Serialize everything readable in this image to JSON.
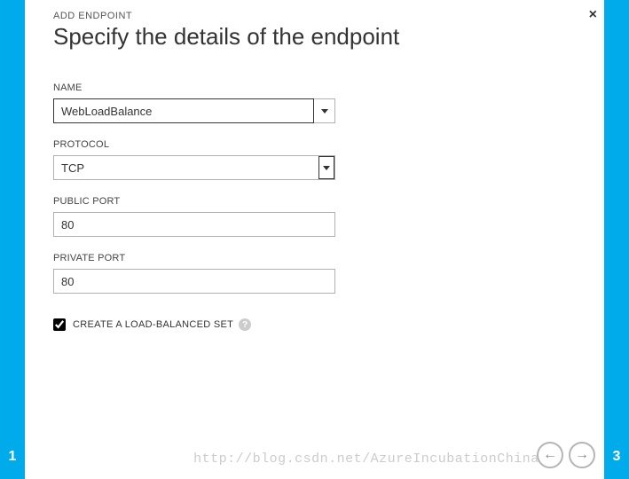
{
  "wizard": {
    "leftStep": "1",
    "rightStep": "3"
  },
  "header": {
    "breadcrumb": "ADD ENDPOINT",
    "title": "Specify the details of the endpoint"
  },
  "fields": {
    "name": {
      "label": "NAME",
      "value": "WebLoadBalance"
    },
    "protocol": {
      "label": "PROTOCOL",
      "value": "TCP"
    },
    "publicPort": {
      "label": "PUBLIC PORT",
      "value": "80"
    },
    "privatePort": {
      "label": "PRIVATE PORT",
      "value": "80"
    },
    "loadBalanced": {
      "label": "CREATE A LOAD-BALANCED SET",
      "checked": true
    }
  },
  "watermark": "http://blog.csdn.net/AzureIncubationChina"
}
